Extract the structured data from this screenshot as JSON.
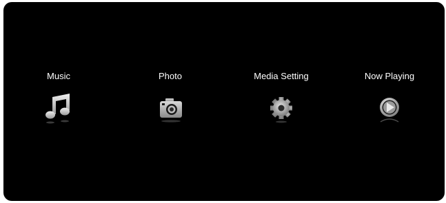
{
  "colors": {
    "background": "#000000",
    "label": "#ffffff",
    "icon": "#cfcfcf"
  },
  "menu": {
    "items": [
      {
        "label": "Music",
        "icon": "music-note-icon"
      },
      {
        "label": "Photo",
        "icon": "camera-icon"
      },
      {
        "label": "Media Setting",
        "icon": "gear-icon"
      },
      {
        "label": "Now Playing",
        "icon": "play-circle-icon"
      }
    ]
  }
}
